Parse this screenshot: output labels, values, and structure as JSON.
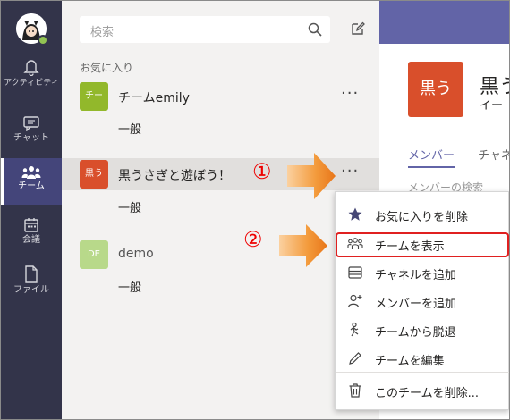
{
  "rail": {
    "items": [
      {
        "label": "アクティビティ"
      },
      {
        "label": "チャット"
      },
      {
        "label": "チーム"
      },
      {
        "label": "会議"
      },
      {
        "label": "ファイル"
      }
    ]
  },
  "panel": {
    "search_placeholder": "検索",
    "favorites_label": "お気に入り",
    "teams": [
      {
        "tile": "チー",
        "name": "チームemily",
        "channel": "一般",
        "color": "#92b82b"
      },
      {
        "tile": "黒う",
        "name": "黒うさぎと遊ぼう！",
        "channel": "一般",
        "color": "#d94f2b"
      },
      {
        "tile": "DE",
        "name": "demo",
        "channel": "一般",
        "color": "#b8d98a"
      }
    ],
    "more": "···"
  },
  "content": {
    "team_tile": "黒う",
    "team_name": "黒う",
    "team_sub": "イー",
    "tab_members": "メンバー",
    "tab_channels": "チャネ",
    "member_search": "メンバーの検索"
  },
  "menu": {
    "items": [
      {
        "label": "お気に入りを削除",
        "icon": "star-icon"
      },
      {
        "label": "チームを表示",
        "icon": "team-icon"
      },
      {
        "label": "チャネルを追加",
        "icon": "channel-icon"
      },
      {
        "label": "メンバーを追加",
        "icon": "add-member-icon"
      },
      {
        "label": "チームから脱退",
        "icon": "leave-icon"
      },
      {
        "label": "チームを編集",
        "icon": "pencil-icon"
      },
      {
        "label": "このチームを削除...",
        "icon": "trash-icon"
      }
    ]
  },
  "annotations": {
    "step1": "①",
    "step2": "②"
  },
  "colors": {
    "rail": "#33344a",
    "accent": "#6264a7",
    "highlight": "#e02020",
    "arrow": "#f08a24"
  }
}
